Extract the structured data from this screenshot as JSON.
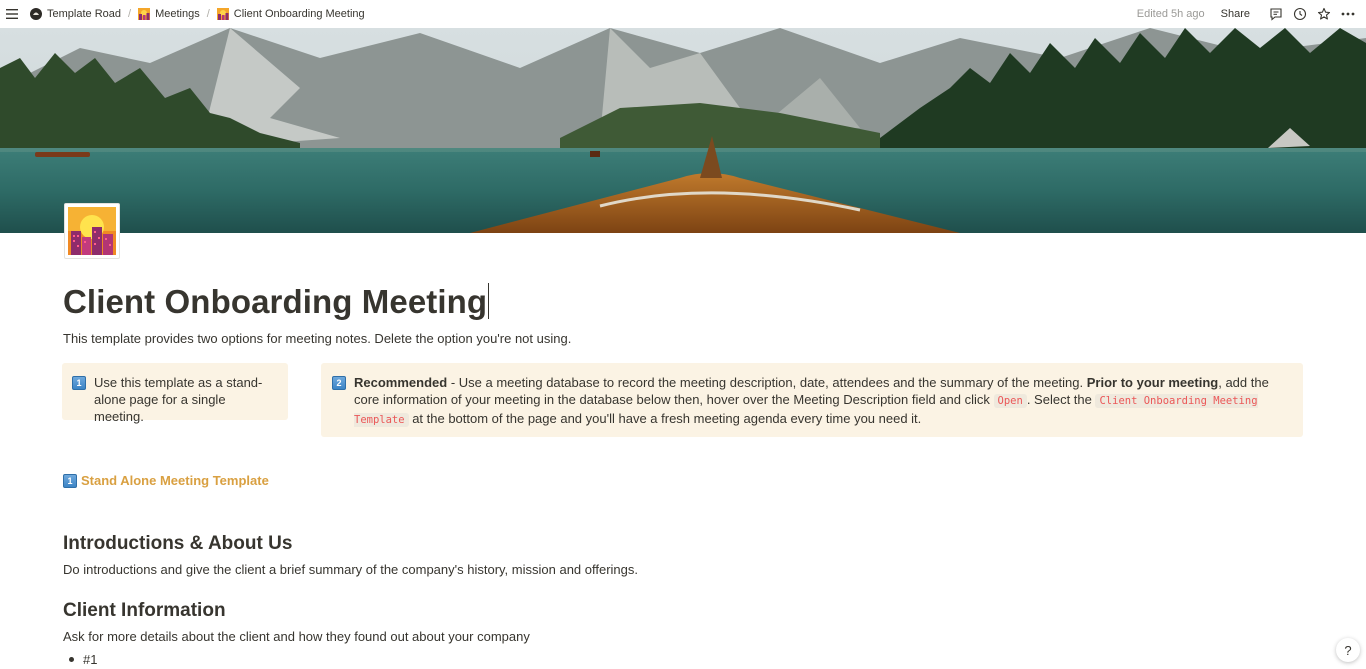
{
  "breadcrumb": {
    "items": [
      {
        "label": "Template Road",
        "icon": "workspace-avatar-icon"
      },
      {
        "label": "Meetings",
        "icon": "city-sunset-icon"
      },
      {
        "label": "Client Onboarding Meeting",
        "icon": "city-sunset-icon"
      }
    ],
    "separator": "/"
  },
  "topbar": {
    "edited": "Edited 5h ago",
    "share_label": "Share"
  },
  "page": {
    "title": "Client Onboarding Meeting",
    "description": "This template provides two options for meeting notes. Delete the option you're not using."
  },
  "callout1": {
    "badge": "1",
    "text": "Use this template as a stand-alone page for a single meeting."
  },
  "callout2": {
    "badge": "2",
    "bold1": "Recommended",
    "text1": " - Use a meeting database to record the meeting description, date, attendees and the summary of the meeting. ",
    "bold2": "Prior to your meeting",
    "text2": ", add the core information of your meeting in the database below then, hover over the Meeting Description field and click ",
    "code1": "Open",
    "text3": ". Select the ",
    "code2": "Client Onboarding Meeting Template",
    "text4": " at the bottom of the page and you'll have a fresh meeting agenda every time you need it."
  },
  "stand_alone": {
    "badge": "1",
    "label": "Stand Alone Meeting Template"
  },
  "sections": [
    {
      "heading": "Introductions & About Us",
      "text": "Do introductions and give the client a brief summary of the company's history, mission and offerings."
    },
    {
      "heading": "Client Information",
      "text": "Ask for more details about the client and how they found out about your company"
    }
  ],
  "bullets": [
    "#1"
  ],
  "help_label": "?",
  "colors": {
    "text": "#37352f",
    "callout_bg": "#fbf3e4",
    "link_orange": "#d9a041",
    "code_red": "#eb5757"
  }
}
